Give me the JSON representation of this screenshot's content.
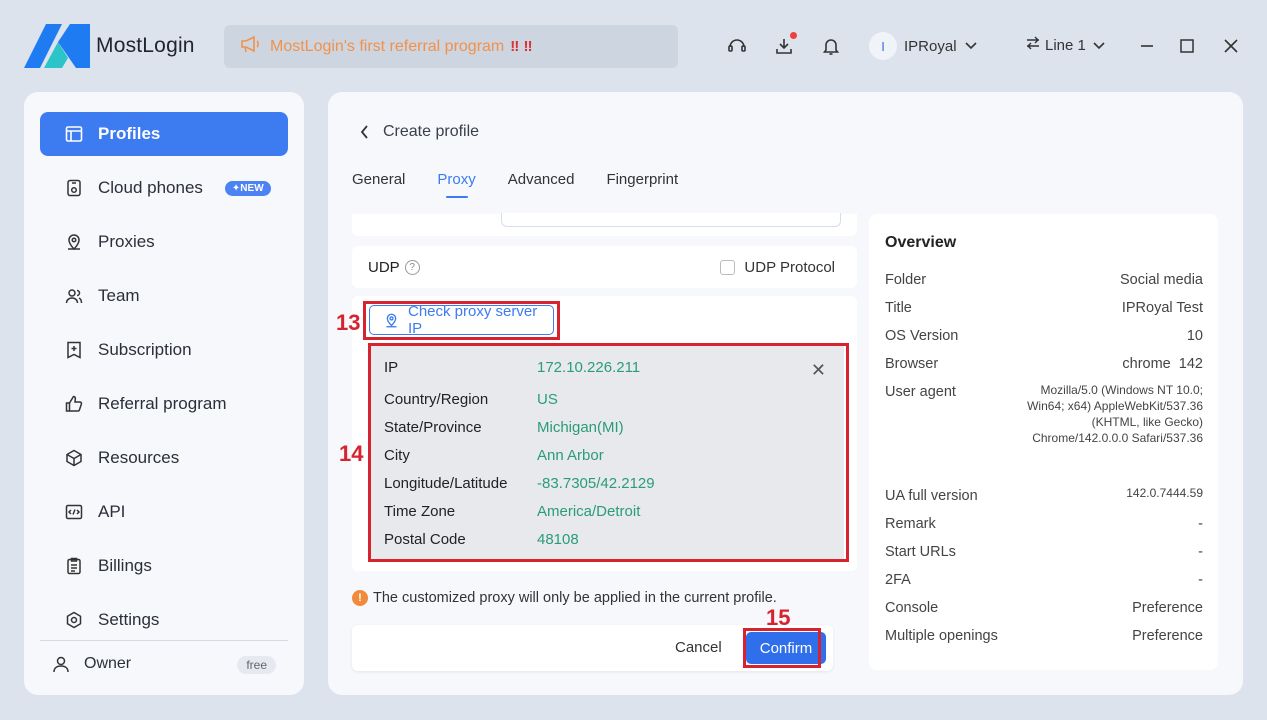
{
  "app": {
    "name": "MostLogin",
    "banner_text": "MostLogin's first referral program",
    "banner_marks": "‼ ‼",
    "user_initial": "I",
    "user_name": "IPRoyal",
    "line_label": "Line 1"
  },
  "sidebar": {
    "items": [
      {
        "label": "Profiles",
        "icon": "profile-window-icon"
      },
      {
        "label": "Cloud phones",
        "icon": "phone-icon",
        "badge": "✦NEW"
      },
      {
        "label": "Proxies",
        "icon": "location-pin-icon"
      },
      {
        "label": "Team",
        "icon": "team-icon"
      },
      {
        "label": "Subscription",
        "icon": "subscription-icon"
      },
      {
        "label": "Referral program",
        "icon": "thumbs-up-icon"
      },
      {
        "label": "Resources",
        "icon": "cube-icon"
      },
      {
        "label": "API",
        "icon": "code-icon"
      },
      {
        "label": "Billings",
        "icon": "clipboard-icon"
      },
      {
        "label": "Settings",
        "icon": "gear-icon"
      }
    ],
    "owner_label": "Owner",
    "owner_plan": "free"
  },
  "main": {
    "page_title": "Create profile",
    "tabs": [
      "General",
      "Proxy",
      "Advanced",
      "Fingerprint"
    ],
    "active_tab": "Proxy",
    "udp_label": "UDP",
    "udp_checkbox_label": "UDP Protocol",
    "check_button_label": "Check proxy server IP",
    "step_labels": {
      "check": "13",
      "result": "14",
      "confirm": "15"
    },
    "ip_info": [
      {
        "key": "IP",
        "value": "172.10.226.211"
      },
      {
        "key": "Country/Region",
        "value": "US"
      },
      {
        "key": "State/Province",
        "value": "Michigan(MI)"
      },
      {
        "key": "City",
        "value": "Ann Arbor"
      },
      {
        "key": "Longitude/Latitude",
        "value": "-83.7305/42.2129"
      },
      {
        "key": "Time Zone",
        "value": "America/Detroit"
      },
      {
        "key": "Postal Code",
        "value": "48108"
      }
    ],
    "notice": "The customized proxy will only be applied in the current profile.",
    "cancel_label": "Cancel",
    "confirm_label": "Confirm"
  },
  "overview": {
    "title": "Overview",
    "rows": [
      {
        "key": "Folder",
        "value": "Social media"
      },
      {
        "key": "Title",
        "value": "IPRoyal Test"
      },
      {
        "key": "OS Version",
        "value": "10"
      },
      {
        "key": "Browser",
        "value": "chrome  142"
      },
      {
        "key": "User agent",
        "value": "Mozilla/5.0 (Windows NT 10.0; Win64; x64) AppleWebKit/537.36 (KHTML, like Gecko) Chrome/142.0.0.0 Safari/537.36"
      },
      {
        "key": "UA full version",
        "value": "142.0.7444.59"
      },
      {
        "key": "Remark",
        "value": "-"
      },
      {
        "key": "Start URLs",
        "value": "-"
      },
      {
        "key": "2FA",
        "value": "-"
      },
      {
        "key": "Console",
        "value": "Preference"
      },
      {
        "key": "Multiple openings",
        "value": "Preference"
      }
    ]
  },
  "colors": {
    "accent": "#3d7bf0",
    "highlight": "#d6232f",
    "ip_value": "#2a9d74",
    "banner_text": "#f2914a"
  }
}
